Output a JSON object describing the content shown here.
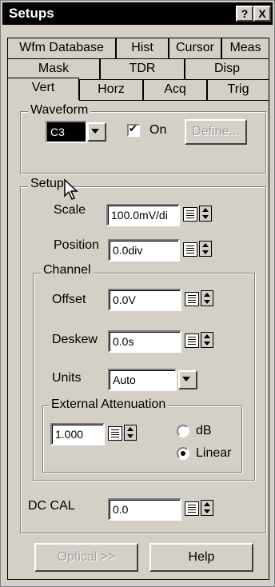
{
  "window": {
    "title": "Setups",
    "help_glyph": "?",
    "close_glyph": "X"
  },
  "tabs": {
    "row1": [
      "Wfm Database",
      "Hist",
      "Cursor",
      "Meas"
    ],
    "row2": [
      "Mask",
      "TDR",
      "Disp"
    ],
    "row3": [
      "Vert",
      "Horz",
      "Acq",
      "Trig"
    ],
    "active": "Vert"
  },
  "waveform": {
    "group_label": "Waveform",
    "source": "C3",
    "on_label": "On",
    "on_checked": true,
    "define_label": "Define..."
  },
  "setup": {
    "group_label": "Setup",
    "scale_label": "Scale",
    "scale_value": "100.0mV/di",
    "position_label": "Position",
    "position_value": "0.0div",
    "channel": {
      "group_label": "Channel",
      "offset_label": "Offset",
      "offset_value": "0.0V",
      "deskew_label": "Deskew",
      "deskew_value": "0.0s",
      "units_label": "Units",
      "units_value": "Auto",
      "ext_atten": {
        "group_label": "External Attenuation",
        "value": "1.000",
        "db_label": "dB",
        "linear_label": "Linear",
        "selected": "Linear"
      }
    },
    "dccal_label": "DC CAL",
    "dccal_value": "0.0"
  },
  "buttons": {
    "optical_label": "Optical >>",
    "help_label": "Help"
  },
  "colors": {
    "face": "#d4d0c8",
    "titlebar": "#000000",
    "field": "#ffffff"
  }
}
